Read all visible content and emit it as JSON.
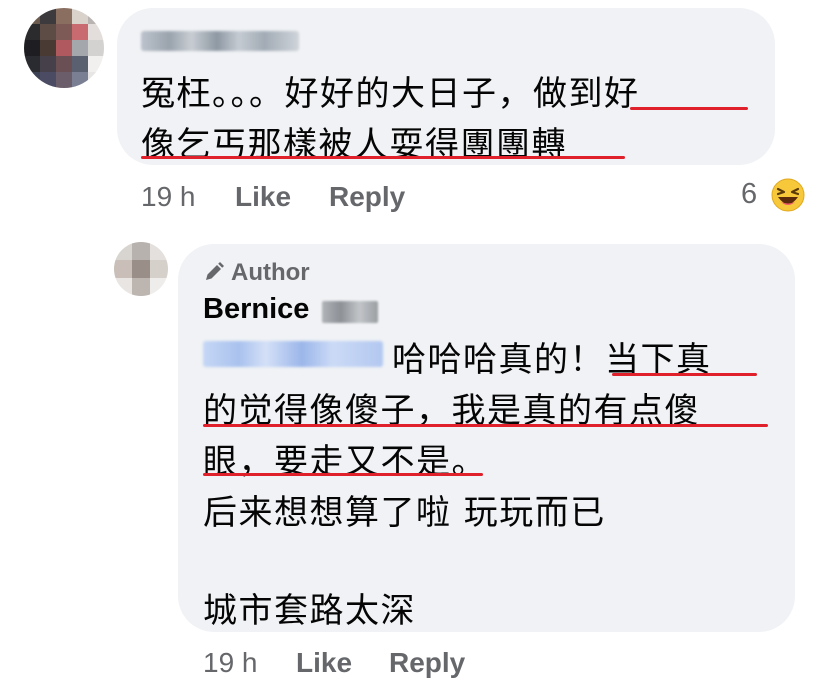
{
  "comment1": {
    "author_visible": "",
    "lines": [
      "冤枉。。。好好的大日子，做到好",
      "像乞丐那樣被人耍得團團轉"
    ],
    "time": "19 h",
    "like_label": "Like",
    "reply_label": "Reply",
    "reaction_count": "6",
    "reaction_icon": "laughing-emoji"
  },
  "reply1": {
    "author_badge": "Author",
    "author_badge_icon": "pencil-icon",
    "author_name": "Bernice",
    "lines": [
      "哈哈哈真的！当下真",
      "的觉得像傻子，我是真的有点傻",
      "眼，要走又不是。",
      "后来想想算了啦 玩玩而已",
      "",
      "城市套路太深"
    ],
    "time": "19 h",
    "like_label": "Like",
    "reply_label": "Reply"
  },
  "colors": {
    "bubble": "#f0f2f5",
    "meta_text": "#65676b",
    "underline": "#e0202a",
    "mention_blur": "#b3c8f0"
  }
}
